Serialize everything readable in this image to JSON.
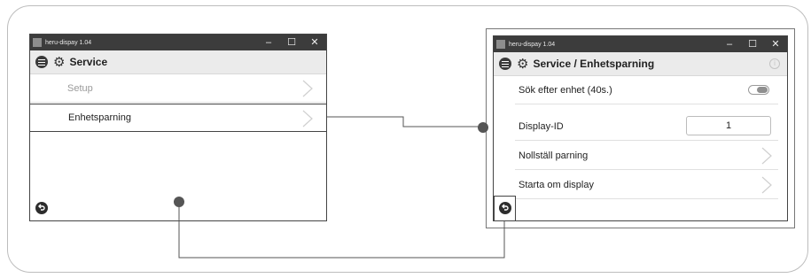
{
  "left_window": {
    "titlebar": "heru-dispay 1.04",
    "controls": [
      "–",
      "☐",
      "✕"
    ],
    "header_title": "Service",
    "rows": [
      {
        "label": "Setup",
        "muted": true
      },
      {
        "label": "Enhetsparning",
        "muted": false
      }
    ]
  },
  "right_window": {
    "titlebar": "heru-dispay 1.04",
    "controls": [
      "–",
      "☐",
      "✕"
    ],
    "header_title": "Service / Enhetsparning",
    "info_glyph": "i",
    "rows": [
      {
        "label": "Sök efter enhet (40s.)",
        "control": "toggle"
      },
      {
        "label": "Display-ID",
        "control": "input",
        "value": "1"
      },
      {
        "label": "Nollställ parning",
        "control": "chevron"
      },
      {
        "label": "Starta om display",
        "control": "chevron"
      }
    ]
  },
  "icons": {
    "menu": "menu-circle-icon",
    "gear": "gear-icon",
    "back": "back-arrow-icon",
    "chevron": "chevron-right-icon"
  },
  "colors": {
    "titlebar": "#3c3c3c",
    "header": "#ebebeb",
    "connector": "#555555"
  }
}
